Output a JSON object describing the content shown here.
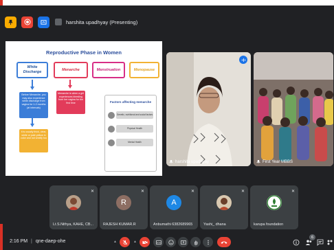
{
  "app": "Google Meet",
  "presenter": {
    "status_text": "harshita upadhyay (Presenting)"
  },
  "toolbar": {
    "icons": [
      "pin-icon",
      "record-icon",
      "screen-share-icon",
      "presenter-avatar-icon"
    ]
  },
  "slide": {
    "title": "Reproductive Phase in Women",
    "phases": [
      "White Discharge",
      "Menarche",
      "Menstruation",
      "Menopause"
    ],
    "note_blue": "Before Menarche, you may also experience white discharge from vagina for 1-2 months (at intervals)",
    "note_red": "Menarche is when a girl experiences bleeding from her vagina for the first time",
    "note_orange": "It is usually thick, clear, white or pale yellow in color and not smelly too",
    "factors": {
      "title": "Factors affecting menarche",
      "items": [
        "Genetic, nutritional and social factors",
        "Physical Health",
        "Mental Health"
      ]
    }
  },
  "tiles": {
    "speaker": {
      "name": "harshita upadhyay",
      "speaking_icon": "audio-level-icon"
    },
    "room": {
      "name": "First Year MBBS"
    }
  },
  "participants": [
    {
      "name": "Lt.S.Nithya, KAHE, CB...",
      "avatar_type": "photo",
      "avatar_color": "#6d4c41"
    },
    {
      "name": "RAJESH KUMAR.R",
      "avatar_type": "letter",
      "letter": "R",
      "avatar_color": "#8d6e63"
    },
    {
      "name": "Anbumathi 6382689965",
      "avatar_type": "letter",
      "letter": "A",
      "avatar_color": "#1e88e5"
    },
    {
      "name": "Yashi_ dhana",
      "avatar_type": "photo",
      "avatar_color": "#5d4037"
    },
    {
      "name": "karupa foundation",
      "avatar_type": "logo",
      "avatar_color": "#ffffff"
    }
  ],
  "bottom": {
    "time": "2:16 PM",
    "separator": "|",
    "meeting_code": "qne-daep-ohe",
    "participant_count": "6",
    "controls": [
      "mic-off",
      "camera-off",
      "captions",
      "emoji",
      "present",
      "raise-hand",
      "more-options",
      "leave-call"
    ],
    "right": [
      "info-icon",
      "people-icon",
      "chat-icon",
      "activities-icon"
    ]
  },
  "colors": {
    "background": "#202124",
    "tile": "#3c4043",
    "danger": "#ea4335",
    "accent_blue": "#1a73e8",
    "slide_title": "#2a4d9b"
  }
}
